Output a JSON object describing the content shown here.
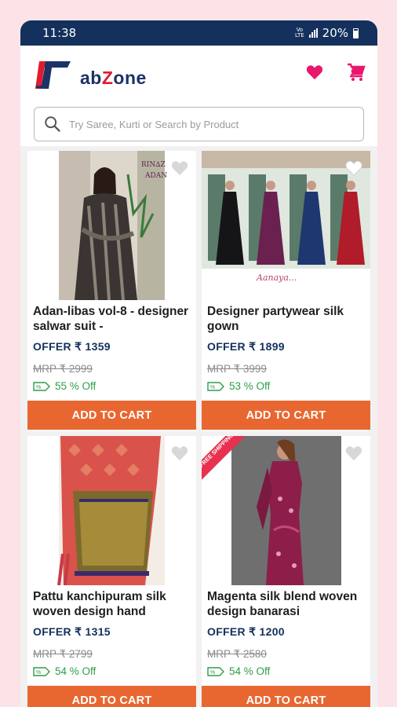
{
  "status": {
    "time": "11:38",
    "network": "Vo LTE",
    "battery": "20%"
  },
  "header": {
    "logo_text_a": "ab",
    "logo_text_z": "Z",
    "logo_text_b": "one",
    "wishlist_icon": "heart-icon",
    "cart_icon": "cart-icon"
  },
  "search": {
    "placeholder": "Try Saree, Kurti or Search by Product"
  },
  "products": [
    {
      "title": "Adan-libas vol-8 - designer salwar suit -",
      "offer": "OFFER ₹ 1359",
      "mrp": "MRP ₹ 2999",
      "discount": "55 % Off",
      "button": "ADD TO CART"
    },
    {
      "title": "Designer partywear silk gown",
      "offer": "OFFER ₹ 1899",
      "mrp": "MRP ₹ 3999",
      "discount": "53 % Off",
      "button": "ADD TO CART"
    },
    {
      "title": "Pattu kanchipuram silk woven design hand",
      "offer": "OFFER ₹ 1315",
      "mrp": "MRP ₹ 2799",
      "discount": "54 % Off",
      "button": "ADD TO CART"
    },
    {
      "title": "Magenta silk blend woven design banarasi",
      "offer": "OFFER ₹ 1200",
      "mrp": "MRP ₹ 2580",
      "discount": "54 % Off",
      "button": "ADD TO CART",
      "badge": "FREE SHIPPING"
    }
  ],
  "colors": {
    "brand_navy": "#14305c",
    "accent_pink": "#e8186e",
    "cart_button": "#e86730",
    "discount_green": "#2e9e4a"
  }
}
